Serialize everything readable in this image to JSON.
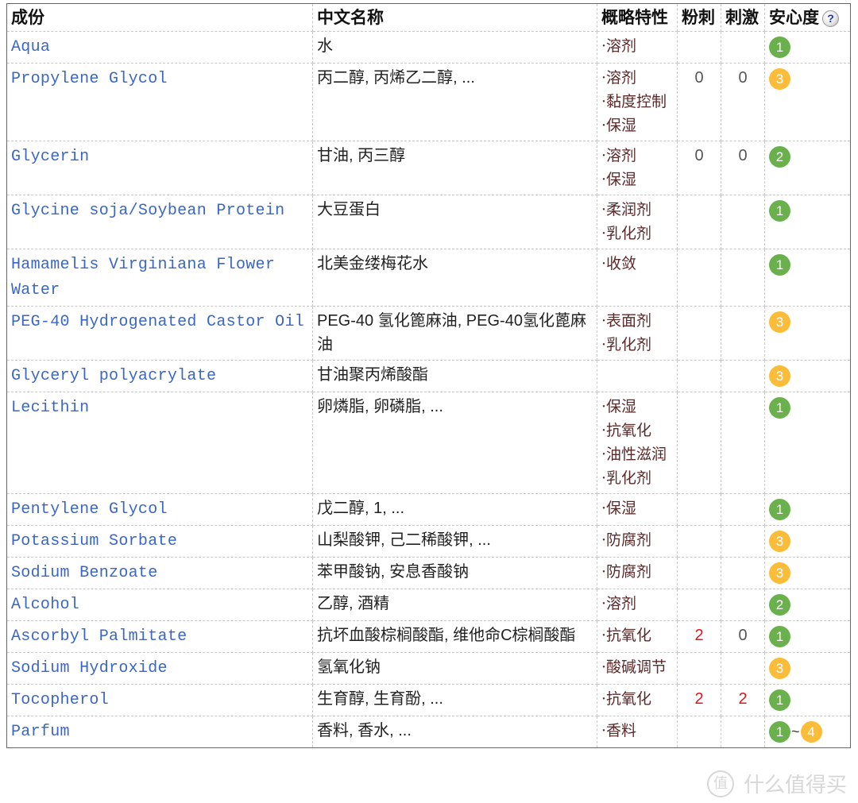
{
  "header": {
    "col_ingredient": "成份",
    "col_chinese_name": "中文名称",
    "col_features": "概略特性",
    "col_acne": "粉刺",
    "col_irritation": "刺激",
    "col_safety": "安心度",
    "help_icon_glyph": "?"
  },
  "colors": {
    "link": "#3a66c8",
    "safety_green": "#6ab04c",
    "safety_orange": "#fbbc3a",
    "warning_red": "#e0141e"
  },
  "rows": [
    {
      "name": "Aqua",
      "cn": "水",
      "features": [
        "·溶剂"
      ],
      "acne": "",
      "irritation": "",
      "safety": [
        "1"
      ]
    },
    {
      "name": "Propylene Glycol",
      "cn": "丙二醇, 丙烯乙二醇, ...",
      "features": [
        "·溶剂",
        "·黏度控制",
        "·保湿"
      ],
      "acne": "0",
      "irritation": "0",
      "safety": [
        "3"
      ]
    },
    {
      "name": "Glycerin",
      "cn": "甘油, 丙三醇",
      "features": [
        "·溶剂",
        "·保湿"
      ],
      "acne": "0",
      "irritation": "0",
      "safety": [
        "2"
      ]
    },
    {
      "name": "Glycine soja/Soybean Protein",
      "cn": "大豆蛋白",
      "features": [
        "·柔润剂",
        "·乳化剂"
      ],
      "acne": "",
      "irritation": "",
      "safety": [
        "1"
      ]
    },
    {
      "name": "Hamamelis Virginiana Flower Water",
      "cn": "北美金缕梅花水",
      "features": [
        "·收敛"
      ],
      "acne": "",
      "irritation": "",
      "safety": [
        "1"
      ]
    },
    {
      "name": "PEG-40 Hydrogenated Castor Oil",
      "cn": "PEG-40 氢化篦麻油, PEG-40氢化蓖麻油",
      "features": [
        "·表面剂",
        "·乳化剂"
      ],
      "acne": "",
      "irritation": "",
      "safety": [
        "3"
      ]
    },
    {
      "name": "Glyceryl polyacrylate",
      "cn": "甘油聚丙烯酸酯",
      "features": [],
      "acne": "",
      "irritation": "",
      "safety": [
        "3"
      ]
    },
    {
      "name": "Lecithin",
      "cn": "卵燐脂, 卵磷脂, ...",
      "features": [
        "·保湿",
        "·抗氧化",
        "·油性滋润",
        "·乳化剂"
      ],
      "acne": "",
      "irritation": "",
      "safety": [
        "1"
      ]
    },
    {
      "name": "Pentylene Glycol",
      "cn": "戊二醇, 1, ...",
      "features": [
        "·保湿"
      ],
      "acne": "",
      "irritation": "",
      "safety": [
        "1"
      ]
    },
    {
      "name": "Potassium Sorbate",
      "cn": "山梨酸钾, 己二稀酸钾, ...",
      "features": [
        "·防腐剂"
      ],
      "acne": "",
      "irritation": "",
      "safety": [
        "3"
      ]
    },
    {
      "name": "Sodium Benzoate",
      "cn": "苯甲酸钠, 安息香酸钠",
      "features": [
        "·防腐剂"
      ],
      "acne": "",
      "irritation": "",
      "safety": [
        "3"
      ]
    },
    {
      "name": "Alcohol",
      "cn": "乙醇, 酒精",
      "features": [
        "·溶剂"
      ],
      "acne": "",
      "irritation": "",
      "safety": [
        "2"
      ]
    },
    {
      "name": "Ascorbyl Palmitate",
      "cn": "抗坏血酸棕榈酸酯, 维他命C棕榈酸酯",
      "features": [
        "·抗氧化"
      ],
      "acne": "2",
      "irritation": "0",
      "safety": [
        "1"
      ]
    },
    {
      "name": "Sodium Hydroxide",
      "cn": "氢氧化钠",
      "features": [
        "·酸碱调节"
      ],
      "acne": "",
      "irritation": "",
      "safety": [
        "3"
      ]
    },
    {
      "name": "Tocopherol",
      "cn": "生育醇, 生育酚, ...",
      "features": [
        "·抗氧化"
      ],
      "acne": "2",
      "irritation": "2",
      "safety": [
        "1"
      ]
    },
    {
      "name": "Parfum",
      "cn": "香料, 香水, ...",
      "features": [
        "·香料"
      ],
      "acne": "",
      "irritation": "",
      "safety": [
        "1",
        "4"
      ]
    }
  ],
  "safety_range_separator": "~",
  "watermark": {
    "logo_char": "值",
    "text": "什么值得买"
  }
}
